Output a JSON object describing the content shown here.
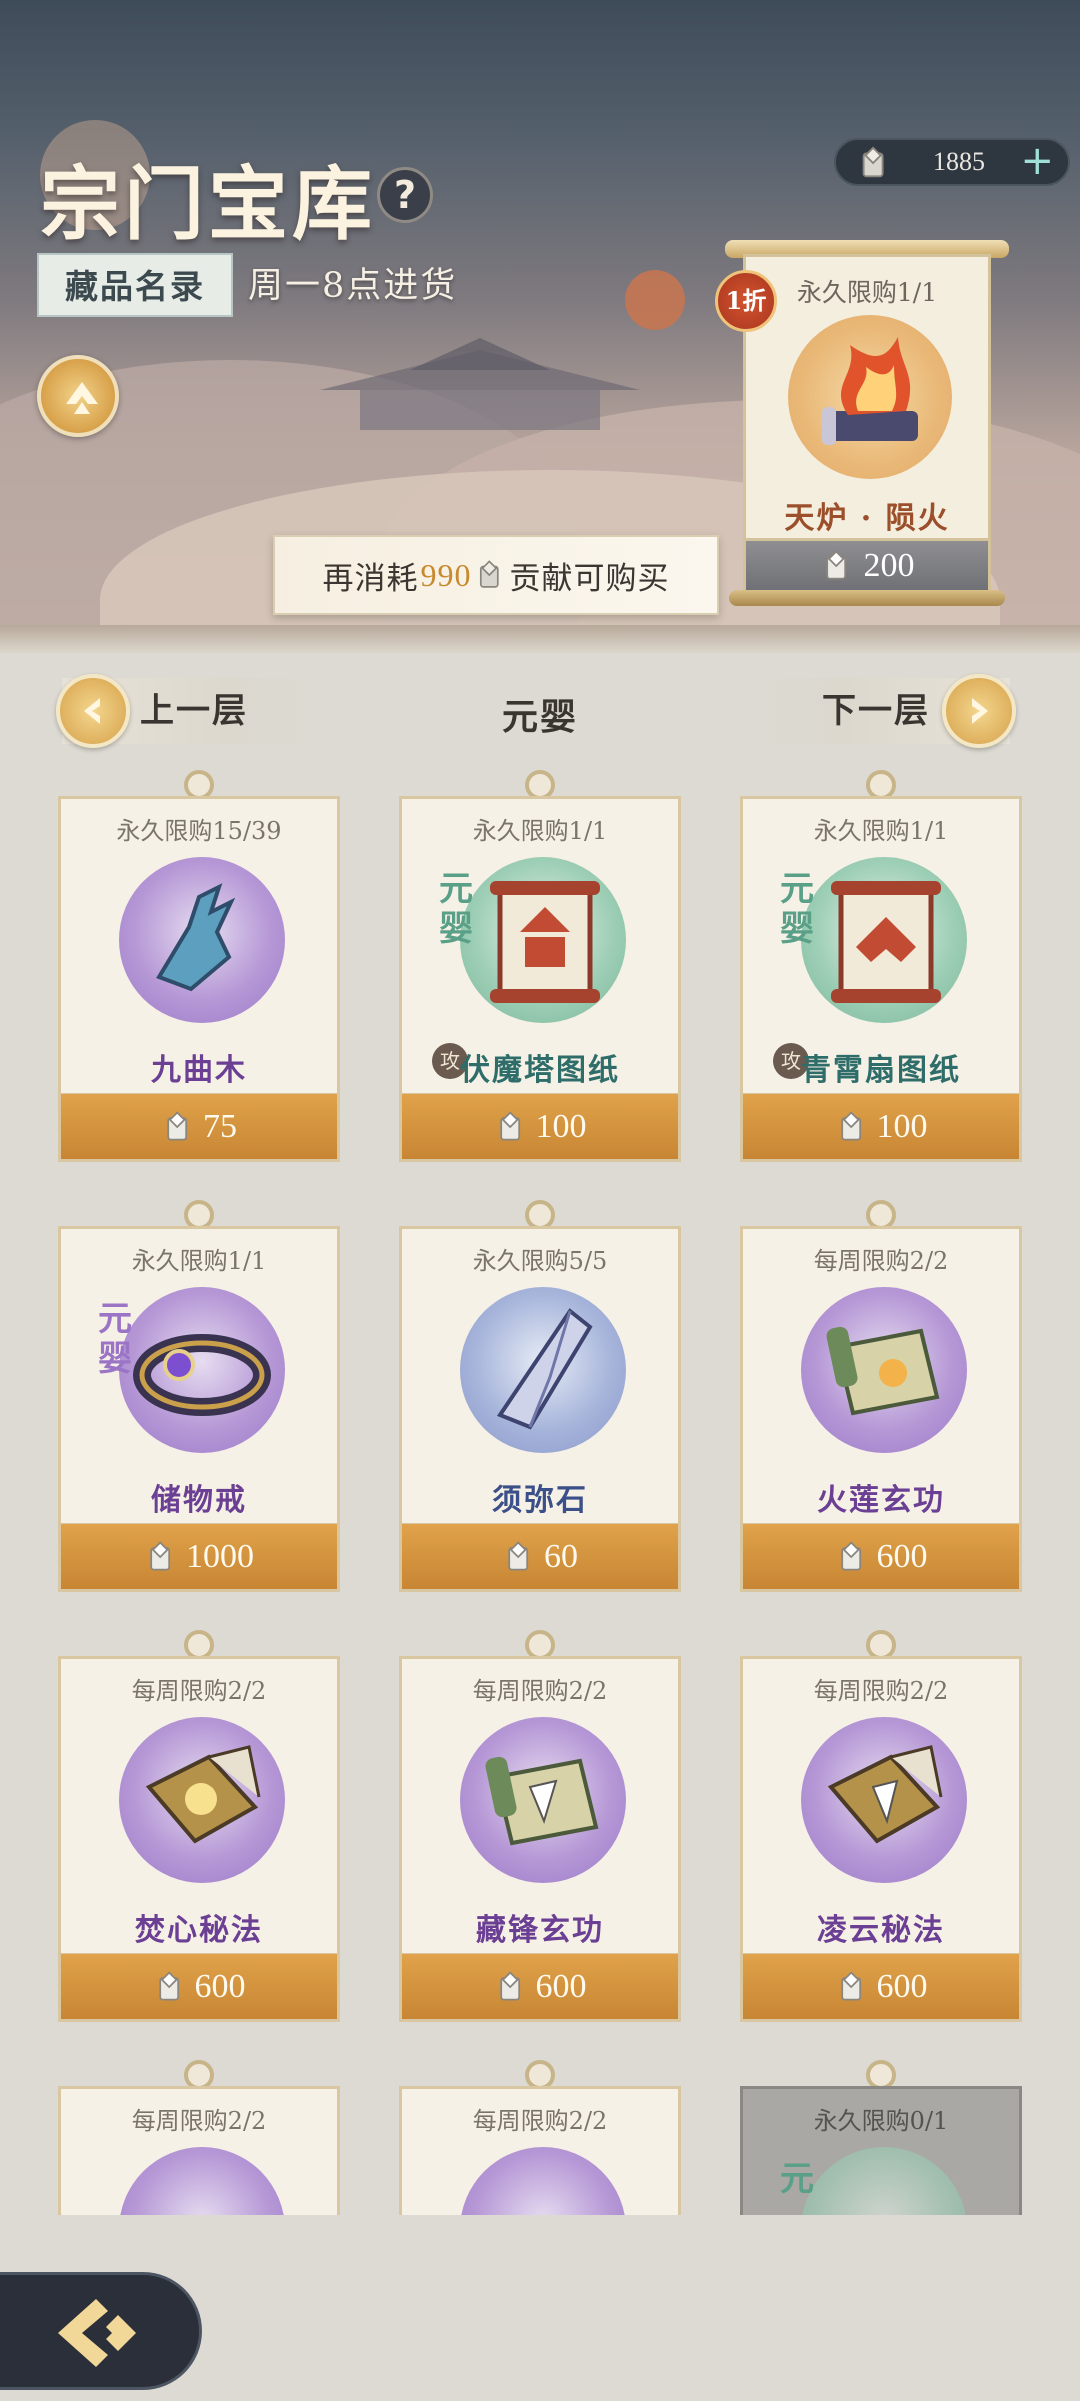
{
  "header": {
    "title": "宗门宝库",
    "help_icon_text": "?",
    "catalog_tab": "藏品名录",
    "restock": "周一8点进货",
    "currency_value": "1885",
    "currency_plus": "+",
    "consume_prefix": "再消耗",
    "consume_amount": "990",
    "consume_suffix": "贡献可购买"
  },
  "featured": {
    "discount": "1折",
    "limit": "永久限购1/1",
    "name": "天炉 · 陨火",
    "price": "200"
  },
  "floor_nav": {
    "prev": "上一层",
    "current": "元婴",
    "next": "下一层"
  },
  "items": [
    {
      "limit": "永久限购15/39",
      "name": "九曲木",
      "price": "75",
      "circle": "purple",
      "tag": "",
      "atk": ""
    },
    {
      "limit": "永久限购1/1",
      "name": "伏魔塔图纸",
      "price": "100",
      "circle": "green",
      "tag": "元婴",
      "atk": "攻"
    },
    {
      "limit": "永久限购1/1",
      "name": "青霄扇图纸",
      "price": "100",
      "circle": "green",
      "tag": "元婴",
      "atk": "攻"
    },
    {
      "limit": "永久限购1/1",
      "name": "储物戒",
      "price": "1000",
      "circle": "purple",
      "tag": "元婴",
      "atk": ""
    },
    {
      "limit": "永久限购5/5",
      "name": "须弥石",
      "price": "60",
      "circle": "blue",
      "tag": "",
      "atk": ""
    },
    {
      "limit": "每周限购2/2",
      "name": "火莲玄功",
      "price": "600",
      "circle": "purple",
      "tag": "",
      "atk": ""
    },
    {
      "limit": "每周限购2/2",
      "name": "焚心秘法",
      "price": "600",
      "circle": "purple",
      "tag": "",
      "atk": ""
    },
    {
      "limit": "每周限购2/2",
      "name": "藏锋玄功",
      "price": "600",
      "circle": "purple",
      "tag": "",
      "atk": ""
    },
    {
      "limit": "每周限购2/2",
      "name": "凌云秘法",
      "price": "600",
      "circle": "purple",
      "tag": "",
      "atk": ""
    },
    {
      "limit": "每周限购2/2",
      "name": "",
      "price": "",
      "circle": "purple",
      "tag": "",
      "atk": ""
    },
    {
      "limit": "每周限购2/2",
      "name": "",
      "price": "",
      "circle": "purple",
      "tag": "",
      "atk": ""
    },
    {
      "limit": "永久限购0/1",
      "name": "",
      "price": "",
      "circle": "green",
      "tag": "元",
      "atk": ""
    }
  ],
  "icons": {
    "currency": "contribution-token-icon",
    "back": "back-arrow-icon",
    "help": "help-icon",
    "expand": "expand-icon"
  }
}
